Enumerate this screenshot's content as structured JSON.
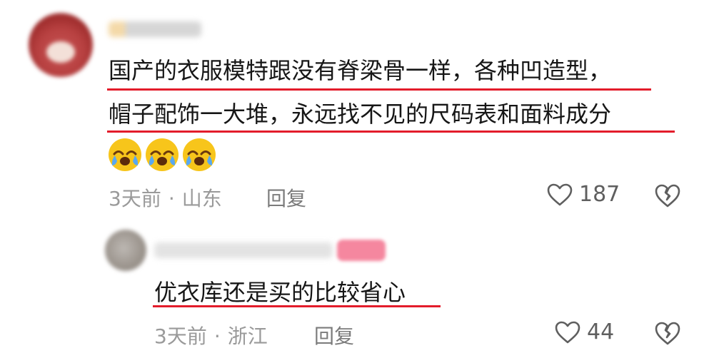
{
  "comments": [
    {
      "text_line1": "国产的衣服模特跟没有脊梁骨一样，各种凹造型，",
      "text_line2": "帽子配饰一大堆，永远找不见的尺码表和面料成分",
      "emojis": [
        "crying-face-emoji",
        "crying-face-emoji",
        "crying-face-emoji"
      ],
      "time": "3天前",
      "separator": "·",
      "location": "山东",
      "reply_label": "回复",
      "likes": "187"
    },
    {
      "text": "优衣库还是买的比较省心",
      "time": "3天前",
      "separator": "·",
      "location": "浙江",
      "reply_label": "回复",
      "likes": "44"
    }
  ],
  "colors": {
    "highlight_underline": "#e31c2b",
    "meta_text": "#9a9a9a",
    "body_text": "#161616"
  },
  "icons": {
    "like": "heart-outline-icon",
    "dislike": "broken-heart-icon"
  }
}
